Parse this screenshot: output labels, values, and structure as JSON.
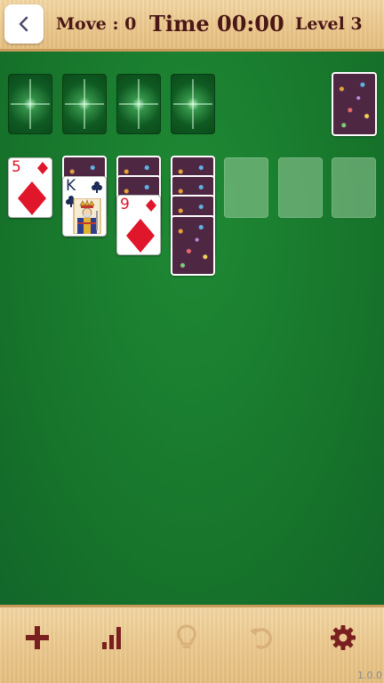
{
  "header": {
    "move_text": "Move : 0",
    "time_text": "Time 00:00",
    "level_text": "Level 3"
  },
  "tableau": {
    "col1_top": {
      "rank": "5",
      "suit": "diamonds",
      "color": "#e0162b"
    },
    "col2_top": {
      "rank": "K",
      "suit": "clubs",
      "color": "#1a2a55"
    },
    "col3_top": {
      "rank": "9",
      "suit": "diamonds",
      "color": "#e0162b"
    }
  },
  "footer": {
    "version": "1.0.0"
  },
  "icons": [
    "back-icon",
    "add-icon",
    "stats-icon",
    "hint-icon",
    "undo-icon",
    "settings-icon"
  ],
  "colors": {
    "felt": "#1a7a2e",
    "card_back": "#4e2743",
    "text_dark": "#4a1616",
    "icon": "#7a1f1f"
  }
}
